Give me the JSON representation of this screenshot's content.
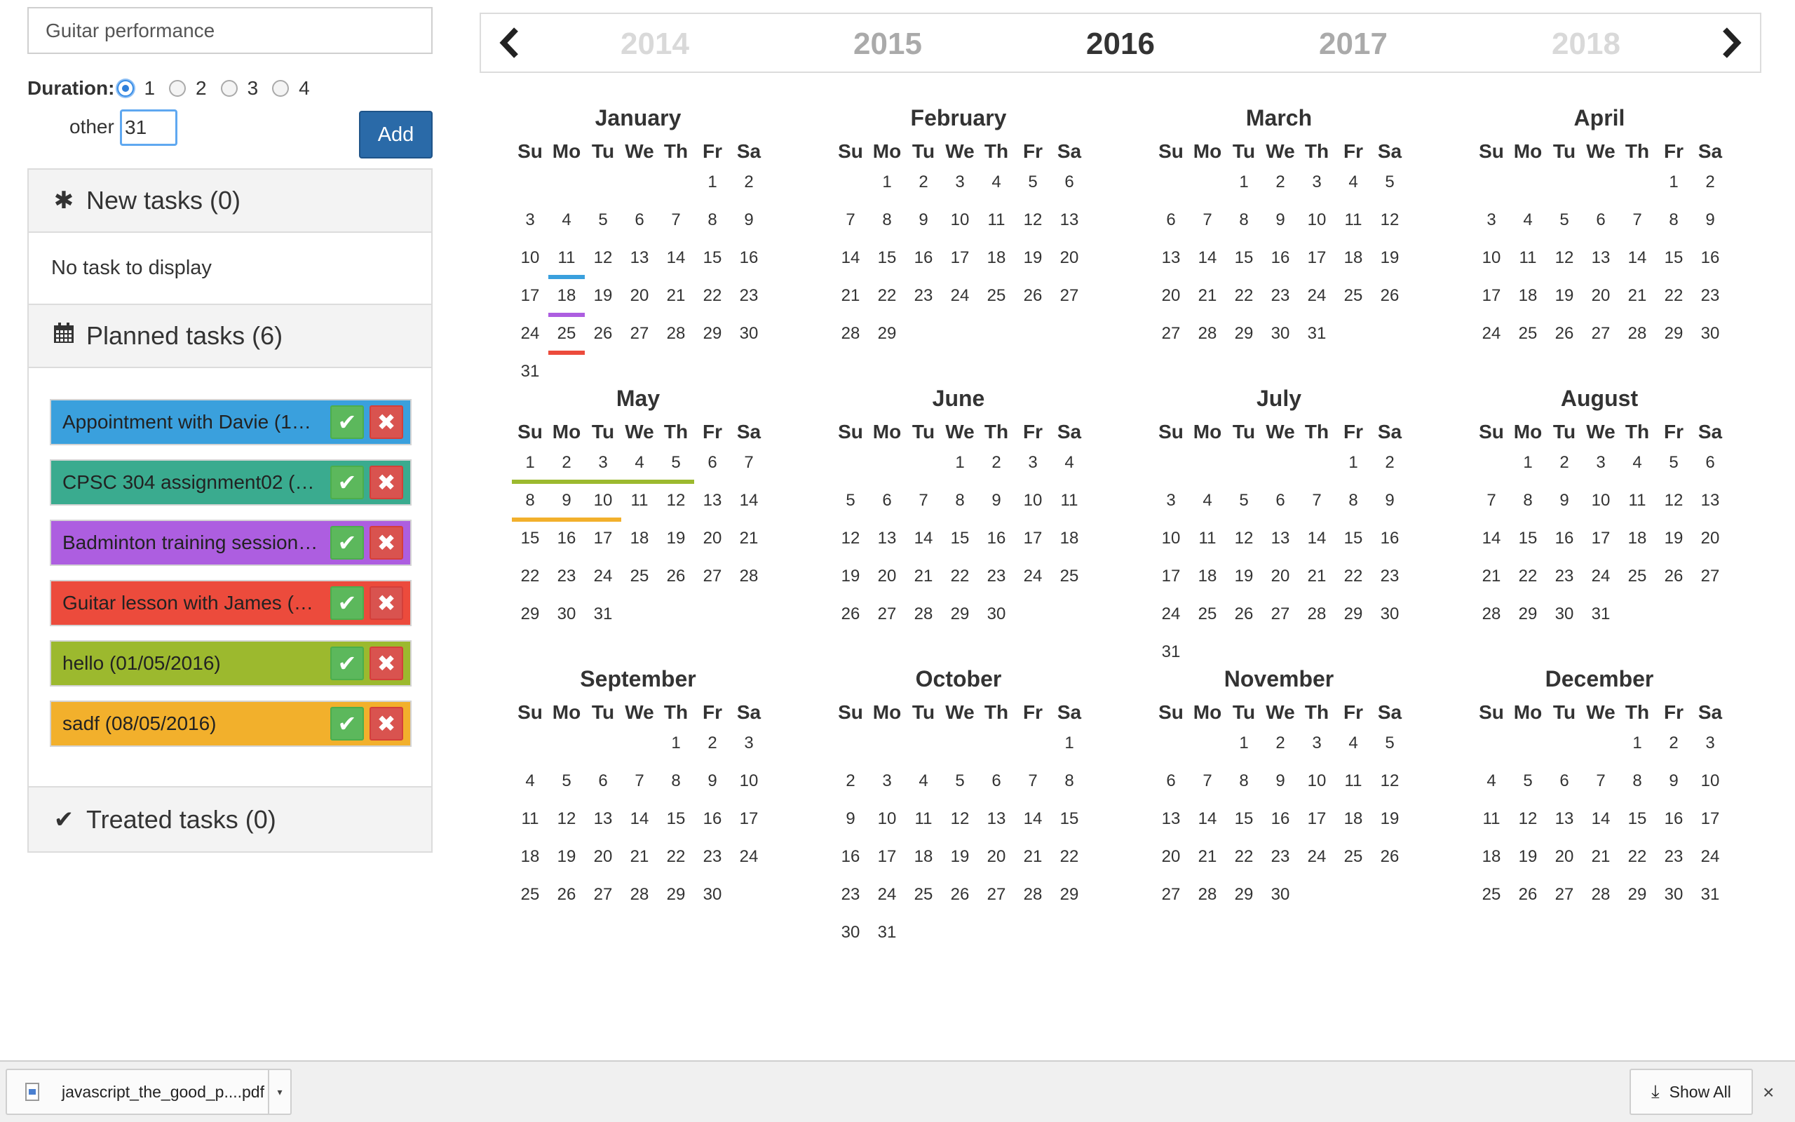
{
  "form": {
    "task_value": "Guitar performance",
    "duration_label": "Duration:",
    "options": [
      "1",
      "2",
      "3",
      "4"
    ],
    "selected_option": "1",
    "other_label": "other",
    "other_value": "31",
    "add_label": "Add"
  },
  "panels": {
    "new_title": "New tasks (0)",
    "new_empty": "No task to display",
    "planned_title": "Planned tasks (6)",
    "treated_title": "Treated tasks (0)"
  },
  "tasks": [
    {
      "label": "Appointment with Davie (1…",
      "color": "#3aa0dd"
    },
    {
      "label": "CPSC 304 assignment02 (…",
      "color": "#3aab8f"
    },
    {
      "label": "Badminton training session…",
      "color": "#ad5ee0"
    },
    {
      "label": "Guitar lesson with James (…",
      "color": "#ec4b3c"
    },
    {
      "label": "hello (01/05/2016)",
      "color": "#9cb92e"
    },
    {
      "label": "sadf (08/05/2016)",
      "color": "#f2b02c"
    }
  ],
  "years": {
    "items": [
      "2014",
      "2015",
      "2016",
      "2017",
      "2018"
    ],
    "current": "2016",
    "colors": [
      "#d9d9d9",
      "#aaaaaa",
      "#333333",
      "#aaaaaa",
      "#d9d9d9"
    ]
  },
  "weekdays": [
    "Su",
    "Mo",
    "Tu",
    "We",
    "Th",
    "Fr",
    "Sa"
  ],
  "months": [
    {
      "name": "January",
      "start": 5,
      "days": 31
    },
    {
      "name": "February",
      "start": 1,
      "days": 29
    },
    {
      "name": "March",
      "start": 2,
      "days": 31
    },
    {
      "name": "April",
      "start": 5,
      "days": 30
    },
    {
      "name": "May",
      "start": 0,
      "days": 31
    },
    {
      "name": "June",
      "start": 3,
      "days": 30
    },
    {
      "name": "July",
      "start": 5,
      "days": 31
    },
    {
      "name": "August",
      "start": 1,
      "days": 31
    },
    {
      "name": "September",
      "start": 4,
      "days": 30
    },
    {
      "name": "October",
      "start": 6,
      "days": 31
    },
    {
      "name": "November",
      "start": 2,
      "days": 30
    },
    {
      "name": "December",
      "start": 4,
      "days": 31
    }
  ],
  "markers": [
    {
      "month": 0,
      "day": 11,
      "color": "#3aa0dd"
    },
    {
      "month": 0,
      "day": 18,
      "color": "#ad5ee0"
    },
    {
      "month": 0,
      "day": 25,
      "color": "#ec4b3c"
    },
    {
      "month": 4,
      "day": 1,
      "color": "#9cb92e"
    },
    {
      "month": 4,
      "day": 2,
      "color": "#9cb92e"
    },
    {
      "month": 4,
      "day": 3,
      "color": "#9cb92e"
    },
    {
      "month": 4,
      "day": 4,
      "color": "#9cb92e"
    },
    {
      "month": 4,
      "day": 5,
      "color": "#9cb92e"
    },
    {
      "month": 4,
      "day": 8,
      "color": "#f2b02c"
    },
    {
      "month": 4,
      "day": 9,
      "color": "#f2b02c"
    },
    {
      "month": 4,
      "day": 10,
      "color": "#f2b02c"
    }
  ],
  "download": {
    "filename": "javascript_the_good_p....pdf",
    "show_all": "Show All",
    "close": "×"
  }
}
